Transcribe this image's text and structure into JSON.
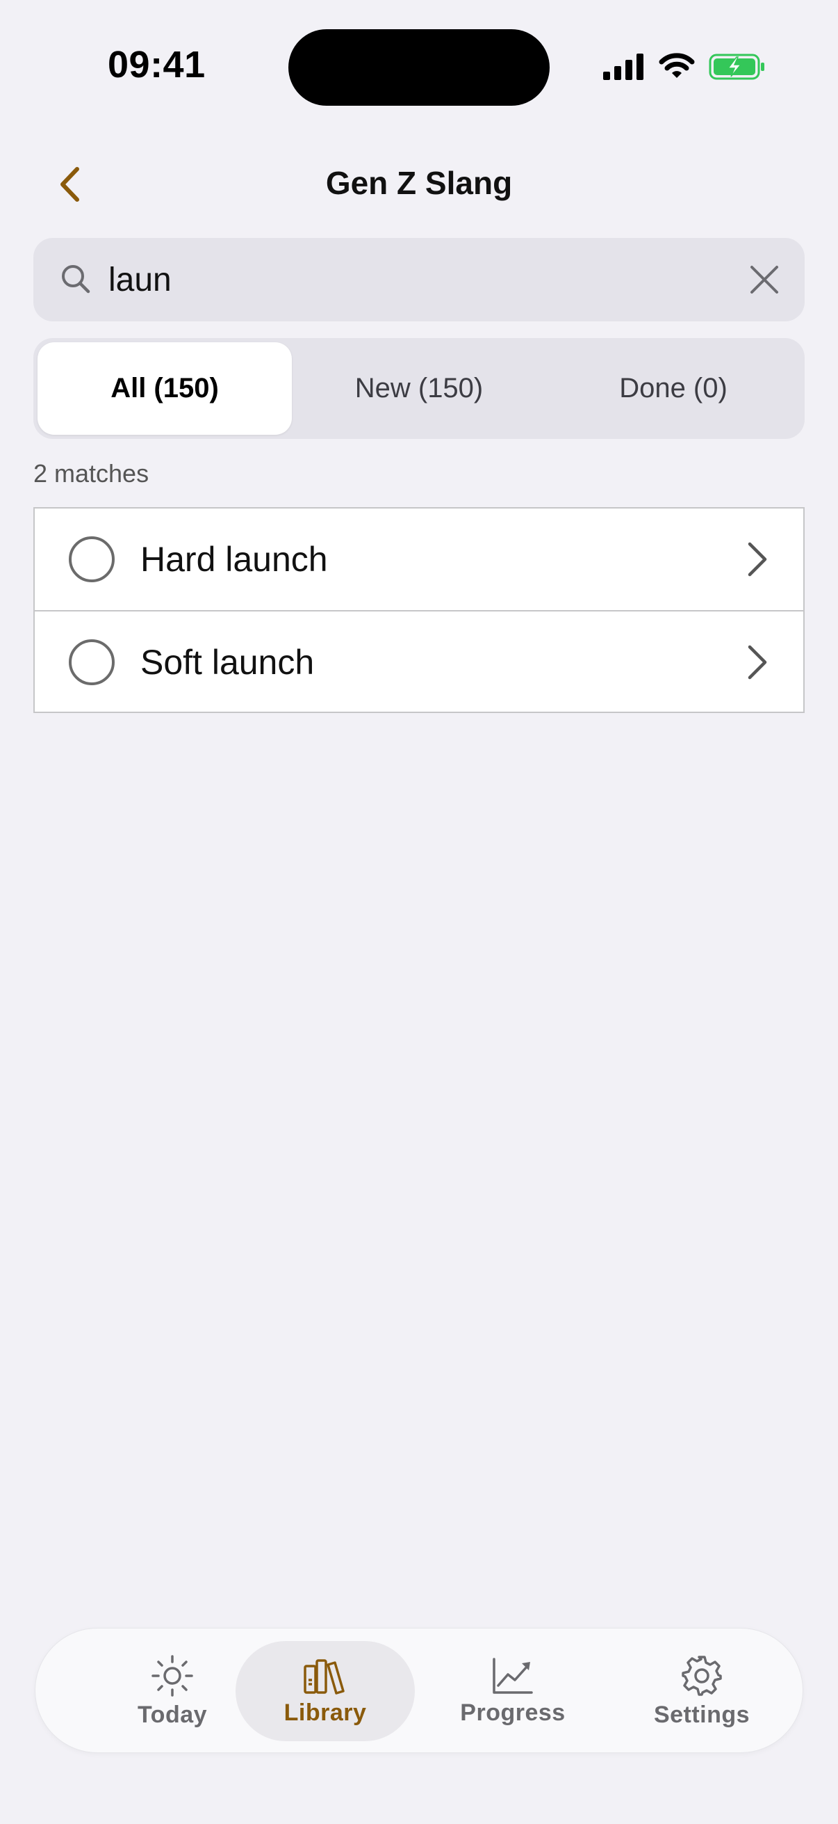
{
  "status_bar": {
    "time": "09:41"
  },
  "nav": {
    "title": "Gen Z Slang"
  },
  "search": {
    "value": "laun",
    "placeholder": "Search"
  },
  "segments": [
    {
      "label": "All (150)",
      "active": true
    },
    {
      "label": "New (150)",
      "active": false
    },
    {
      "label": "Done (0)",
      "active": false
    }
  ],
  "results": {
    "count_label": "2 matches",
    "items": [
      {
        "label": "Hard launch",
        "done": false
      },
      {
        "label": "Soft launch",
        "done": false
      }
    ]
  },
  "tabbar": {
    "tabs": [
      {
        "label": "Today",
        "icon": "sun-icon",
        "active": false
      },
      {
        "label": "Library",
        "icon": "books-icon",
        "active": true
      },
      {
        "label": "Progress",
        "icon": "chart-icon",
        "active": false
      },
      {
        "label": "Settings",
        "icon": "gear-icon",
        "active": false
      }
    ]
  },
  "colors": {
    "accent": "#8a5a0b",
    "background": "#f2f1f6",
    "battery": "#34c759"
  }
}
